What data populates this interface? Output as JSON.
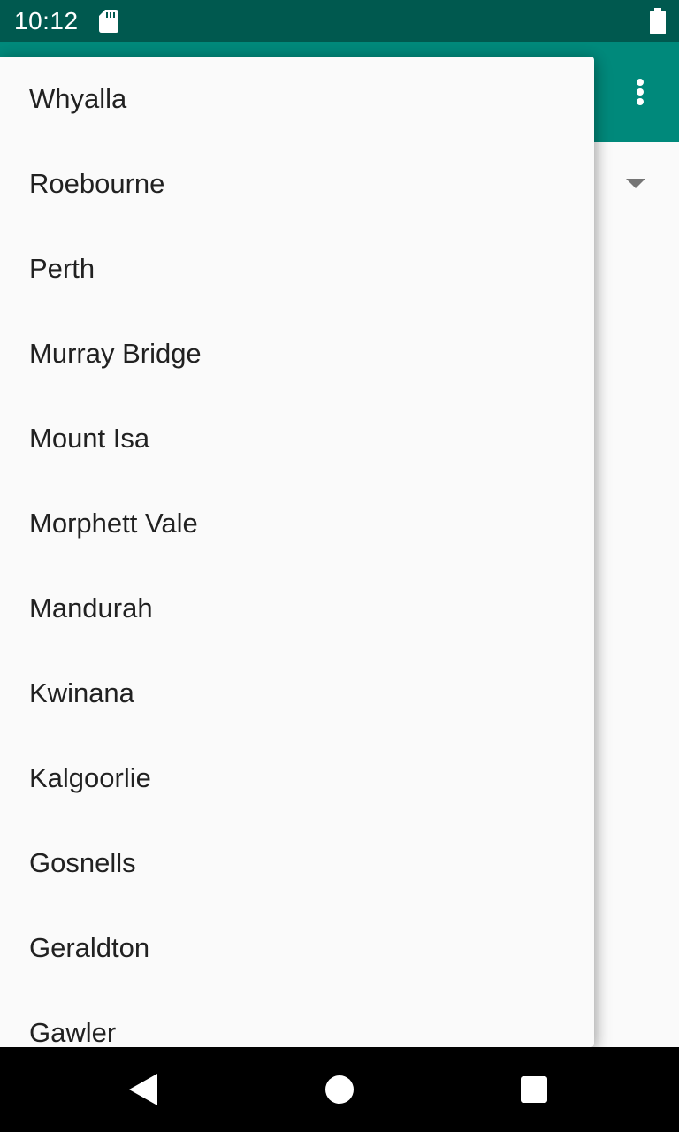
{
  "status_bar": {
    "time": "10:12",
    "icons": [
      "sd-card-icon",
      "battery-icon"
    ]
  },
  "app_bar": {
    "menu_icon": "more-vert-icon",
    "color": "#00897b",
    "status_color": "#00594f"
  },
  "spinner": {
    "arrow_icon": "dropdown-arrow-icon"
  },
  "dropdown": {
    "items": [
      "Whyalla",
      "Roebourne",
      "Perth",
      "Murray Bridge",
      "Mount Isa",
      "Morphett Vale",
      "Mandurah",
      "Kwinana",
      "Kalgoorlie",
      "Gosnells",
      "Geraldton",
      "Gawler"
    ]
  },
  "nav_bar": {
    "icons": [
      "back-icon",
      "home-icon",
      "recents-icon"
    ]
  }
}
